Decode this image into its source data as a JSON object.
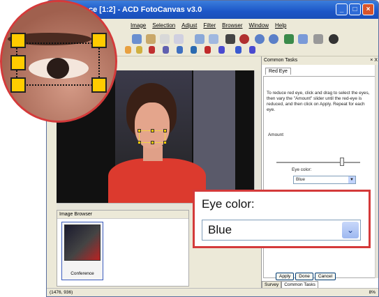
{
  "window": {
    "title": "ce [1:2] - ACD FotoCanvas v3.0",
    "btn_min": "_",
    "btn_max": "□",
    "btn_close": "×"
  },
  "menu": [
    "Image",
    "Selection",
    "Adjust",
    "Filter",
    "Browser",
    "Window",
    "Help"
  ],
  "task_pane": {
    "header": "Common Tasks",
    "close": "× X",
    "tab": "Red Eye",
    "instructions": "To reduce red eye, click and drag to select the eyes, then vary the \"Amount\" slider until the red-eye is reduced, and then click on Apply. Repeat for each eye.",
    "amount_label": "Amount",
    "amount_level": 0.78,
    "eye_color_label": "Eye color:",
    "eye_color_value": "Blue",
    "buttons": [
      "Apply",
      "Done",
      "Cancel"
    ],
    "bottom_tabs": [
      "Survey",
      "Common Tasks"
    ]
  },
  "image_browser": {
    "title": "Image Browser",
    "thumb_label": "Conference"
  },
  "status": {
    "left": "(1476, 936)",
    "right": "8%"
  },
  "callout": {
    "label": "Eye color:",
    "value": "Blue",
    "arrow": "⌄"
  },
  "colors": {
    "accent_red": "#d43a3a",
    "titlebar_blue": "#1c56c7",
    "handle_yellow": "#ffcc00"
  },
  "icons": [
    "dropdown-chevron-icon",
    "select-handle-icon"
  ]
}
